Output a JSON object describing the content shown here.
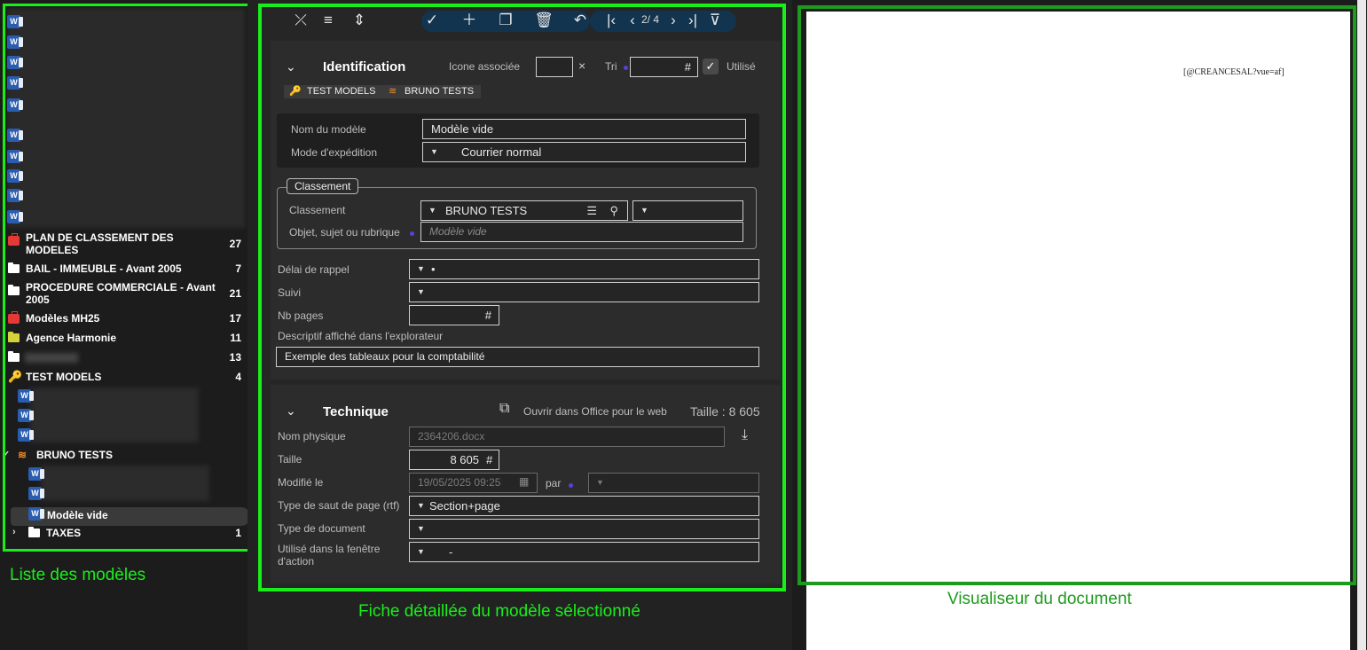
{
  "tree": {
    "nodes": [
      {
        "label": "PLAN DE CLASSEMENT DES MODELES",
        "count": "27",
        "icon": "briefcase-icon"
      },
      {
        "label": "BAIL - IMMEUBLE - Avant 2005",
        "count": "7",
        "icon": "folder-icon"
      },
      {
        "label": "PROCEDURE COMMERCIALE - Avant 2005",
        "count": "21",
        "icon": "folder-icon"
      },
      {
        "label": "Modèles MH25",
        "count": "17",
        "icon": "briefcase-icon"
      },
      {
        "label": "Agence Harmonie",
        "count": "11",
        "icon": "folder-icon"
      },
      {
        "label": "",
        "count": "13",
        "icon": "folder-icon"
      },
      {
        "label": "TEST MODELS",
        "count": "4",
        "icon": "key-icon"
      },
      {
        "label": "BRUNO TESTS",
        "count": "",
        "icon": "stack-icon"
      },
      {
        "label": "Modèle vide",
        "count": "",
        "icon": "word-icon"
      },
      {
        "label": "TAXES",
        "count": "1",
        "icon": "folder-icon"
      }
    ]
  },
  "annotations": {
    "left": "Liste des modèles",
    "middle": "Fiche détaillée du modèle sélectionné",
    "right": "Visualiseur du document"
  },
  "toolbar": {
    "pager": "2/ 4"
  },
  "identification": {
    "title": "Identification",
    "icone_label": "Icone associée",
    "tri_label": "Tri",
    "tri_hash": "#",
    "utilise_label": "Utilisé",
    "chips": [
      "TEST MODELS",
      "BRUNO TESTS"
    ],
    "nom_label": "Nom du modèle",
    "nom_value": "Modèle vide",
    "mode_label": "Mode d'expédition",
    "mode_value": "Courrier normal",
    "classement_legend": "Classement",
    "classement_label": "Classement",
    "classement_value": "BRUNO TESTS",
    "objet_label": "Objet, sujet ou rubrique",
    "objet_placeholder": "Modèle vide",
    "delai_label": "Délai de rappel",
    "delai_value": "•",
    "suivi_label": "Suivi",
    "nbpages_label": "Nb pages",
    "nbpages_hash": "#",
    "descriptif_label": "Descriptif affiché dans l'explorateur",
    "descriptif_value": "Exemple des tableaux pour la comptabilité"
  },
  "technique": {
    "title": "Technique",
    "open_label": "Ouvrir dans Office pour le web",
    "taille_header": "Taille : 8 605",
    "nom_physique_label": "Nom physique",
    "nom_physique_value": "2364206.docx",
    "taille_label": "Taille",
    "taille_value": "8 605",
    "taille_hash": "#",
    "modifie_label": "Modifié le",
    "modifie_value": "19/05/2025 09:25",
    "par_label": "par",
    "saut_label": "Type de saut de page (rtf)",
    "saut_value": "Section+page",
    "type_doc_label": "Type de document",
    "utilise_fenetre_label_1": "Utilisé dans la fenêtre",
    "utilise_fenetre_label_2": "d'action",
    "utilise_fenetre_value": "-"
  },
  "viewer": {
    "merge_field": "[@CREANCESAL?vue=af]"
  }
}
